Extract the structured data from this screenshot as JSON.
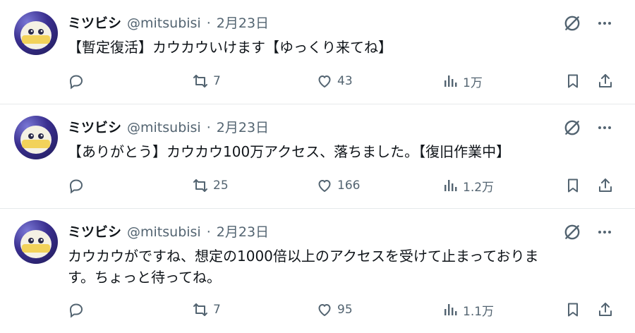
{
  "tweets": [
    {
      "name": "ミツビシ",
      "handle": "@mitsubisi",
      "separator": "·",
      "date": "2月23日",
      "text": "【暫定復活】カウカウいけます【ゆっくり来てね】",
      "replies": "",
      "retweets": "7",
      "likes": "43",
      "views": "1万"
    },
    {
      "name": "ミツビシ",
      "handle": "@mitsubisi",
      "separator": "·",
      "date": "2月23日",
      "text": "【ありがとう】カウカウ100万アクセス、落ちました。【復旧作業中】",
      "replies": "",
      "retweets": "25",
      "likes": "166",
      "views": "1.2万"
    },
    {
      "name": "ミツビシ",
      "handle": "@mitsubisi",
      "separator": "·",
      "date": "2月23日",
      "text": "カウカウがですね、想定の1000倍以上のアクセスを受けて止まっておりま\nす。ちょっと待ってね。",
      "replies": "",
      "retweets": "7",
      "likes": "95",
      "views": "1.1万"
    }
  ],
  "icons": {
    "reply": "reply-icon",
    "retweet": "retweet-icon",
    "like": "heart-icon",
    "views": "views-icon",
    "bookmark": "bookmark-icon",
    "share": "share-icon",
    "grok": "grok-icon",
    "more": "more-icon"
  },
  "colors": {
    "text": "#0f1419",
    "secondary": "#536471",
    "divider": "#e6e9eb"
  }
}
